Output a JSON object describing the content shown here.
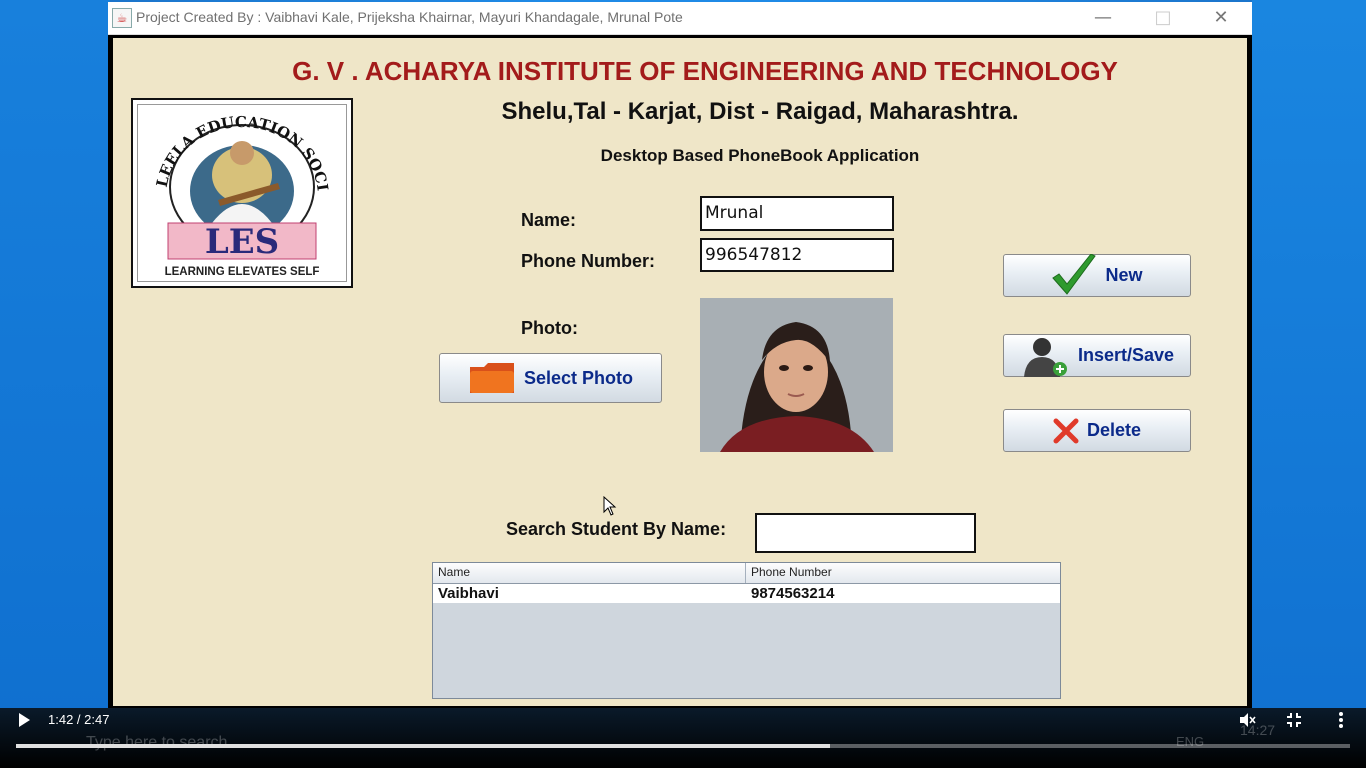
{
  "window": {
    "title": "Project Created By : Vaibhavi Kale, Prijeksha Khairnar, Mayuri Khandagale, Mrunal Pote",
    "minimize_icon": "minimize-icon",
    "maximize_icon": "maximize-icon",
    "close_icon": "close-icon"
  },
  "header": {
    "institute": "G. V . ACHARYA INSTITUTE OF ENGINEERING AND TECHNOLOGY",
    "address": "Shelu,Tal - Karjat, Dist - Raigad, Maharashtra.",
    "app_name": "Desktop Based PhoneBook Application"
  },
  "logo": {
    "arc_text": "LEELA EDUCATION SOCIETY",
    "short": "LES",
    "tagline": "LEARNING ELEVATES SELF"
  },
  "form": {
    "name_label": "Name:",
    "name_value": "Mrunal",
    "phone_label": "Phone Number:",
    "phone_value": "996547812",
    "photo_label": "Photo:",
    "select_photo": "Select Photo"
  },
  "actions": {
    "new": "New",
    "insert_save": "Insert/Save",
    "delete": "Delete"
  },
  "search": {
    "label": "Search Student By Name:",
    "value": ""
  },
  "table": {
    "columns": [
      "Name",
      "Phone Number"
    ],
    "rows": [
      [
        "Vaibhavi",
        "9874563214"
      ]
    ]
  },
  "player": {
    "time": "1:42 / 2:47",
    "progress_fraction": 0.61
  },
  "taskbar": {
    "search_placeholder": "Type here to search",
    "clock": "14:27",
    "lang": "ENG"
  },
  "colors": {
    "panel_bg": "#efe6c8",
    "institute_red": "#a31b1b",
    "button_text": "#0b2a8a"
  }
}
